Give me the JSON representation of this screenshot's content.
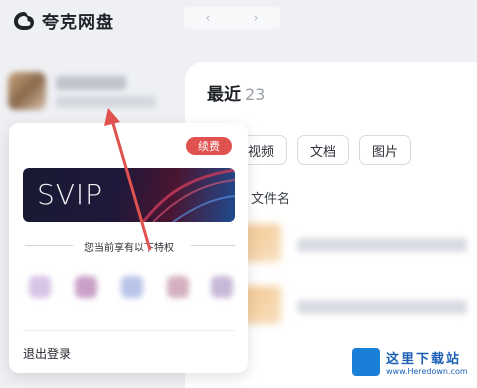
{
  "app": {
    "title": "夸克网盘"
  },
  "nav": {
    "back": "‹",
    "forward": "›"
  },
  "main": {
    "title": "最近",
    "count": "23",
    "filters": [
      "视频",
      "文档",
      "图片"
    ],
    "column_header": "文件名"
  },
  "popup": {
    "renew_label": "续费",
    "svip_label": "SVIP",
    "benefits_title": "您当前享有以下特权",
    "logout_label": "退出登录"
  },
  "watermark": {
    "name": "这里下载站",
    "url": "www.Heredown.com"
  },
  "colors": {
    "accent_red": "#e0524f",
    "arrow_red": "#e0524f",
    "watermark_blue": "#1a7fd6"
  }
}
